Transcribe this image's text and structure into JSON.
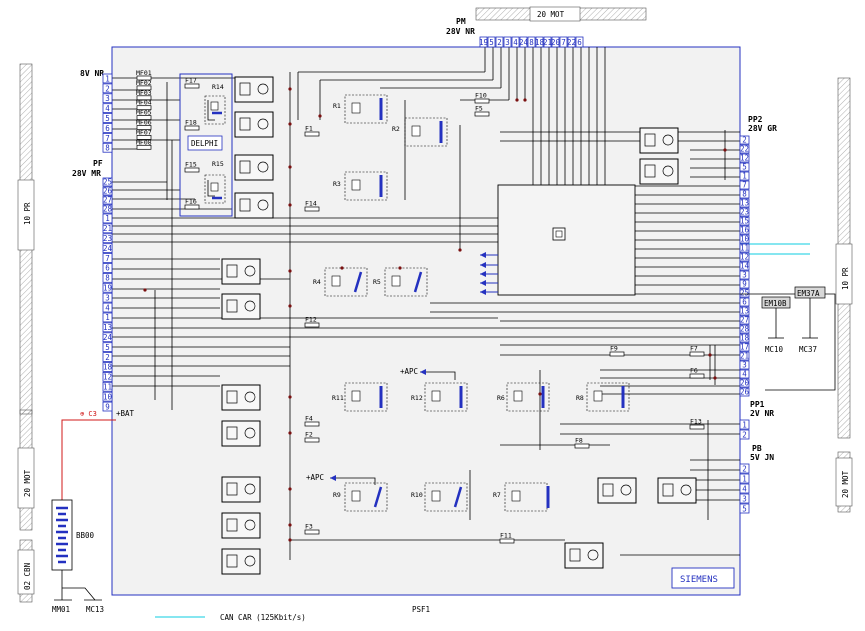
{
  "side_connectors": {
    "left_10pr": "10 PR",
    "left_20mot": "20 MOT",
    "left_02cbn": "02 CBN",
    "right_10pr": "10 PR",
    "right_20mot": "20 MOT",
    "top_20mot": "20 MOT"
  },
  "connectors": {
    "mf_label": "8V NR",
    "pf_label": "PF",
    "pf_sub": "28V MR",
    "pm_label": "PM",
    "pm_sub": "28V NR",
    "pp2_label": "PP2",
    "pp2_sub": "28V GR",
    "pp1_label": "PP1",
    "pp1_sub": "2V NR",
    "pb_label": "PB",
    "pb_sub": "5V JN",
    "bat_label": "+BAT",
    "bat_code": "BB00",
    "ground_1": "MM01",
    "ground_2": "MC13",
    "em10b": "EM10B",
    "em37a": "EM37A",
    "mc10": "MC10",
    "mc37": "MC37",
    "apc_1": "+APC",
    "apc_2": "+APC",
    "fuse_sym": "⊕ C3"
  },
  "pins": {
    "mf": [
      "1",
      "2",
      "3",
      "4",
      "5",
      "6",
      "7",
      "8"
    ],
    "pf": [
      "25",
      "26",
      "27",
      "28",
      "1",
      "21",
      "23",
      "24",
      "7",
      "6",
      "8",
      "19",
      "3",
      "4",
      "1",
      "13",
      "24",
      "5",
      "2",
      "18",
      "12",
      "11",
      "10",
      "9"
    ],
    "pm": [
      "19",
      "5",
      "2",
      "3",
      "4",
      "24",
      "8",
      "18",
      "21",
      "20",
      "7",
      "22",
      "6"
    ],
    "pp2": [
      "2",
      "22",
      "12",
      "5",
      "1",
      "7",
      "8",
      "13",
      "23",
      "15",
      "16",
      "10",
      "11",
      "12",
      "14",
      "3",
      "9",
      "25",
      "6",
      "13",
      "27",
      "28",
      "18",
      "17",
      "21",
      "3",
      "4",
      "20",
      "26"
    ],
    "pp1": [
      "1",
      "2"
    ],
    "pb": [
      "2",
      "1",
      "4",
      "3",
      "5"
    ]
  },
  "fuses": {
    "mf": [
      "MF01",
      "MF02",
      "MF03",
      "MF04",
      "MF05",
      "MF06",
      "MF07",
      "MF08"
    ],
    "internal": [
      "F17",
      "F18",
      "F15",
      "F16",
      "F1",
      "F14",
      "F10",
      "F5",
      "F12",
      "F9",
      "F7",
      "F6",
      "F4",
      "F2",
      "F13",
      "F8",
      "F3",
      "F11"
    ]
  },
  "relays": [
    "R14",
    "R15",
    "R1",
    "R2",
    "R3",
    "R4",
    "R5",
    "R11",
    "R12",
    "R6",
    "R8",
    "R9",
    "R10",
    "R7"
  ],
  "delphi": "DELPHI",
  "brand": "SIEMENS",
  "title": "PSF1",
  "legend_text": "CAN CAR (125Kbit/s)",
  "colors": {
    "can": "#3fd6e6",
    "pin": "#2431c0",
    "box": "#2431c0",
    "bat_wire": "#d01818"
  }
}
